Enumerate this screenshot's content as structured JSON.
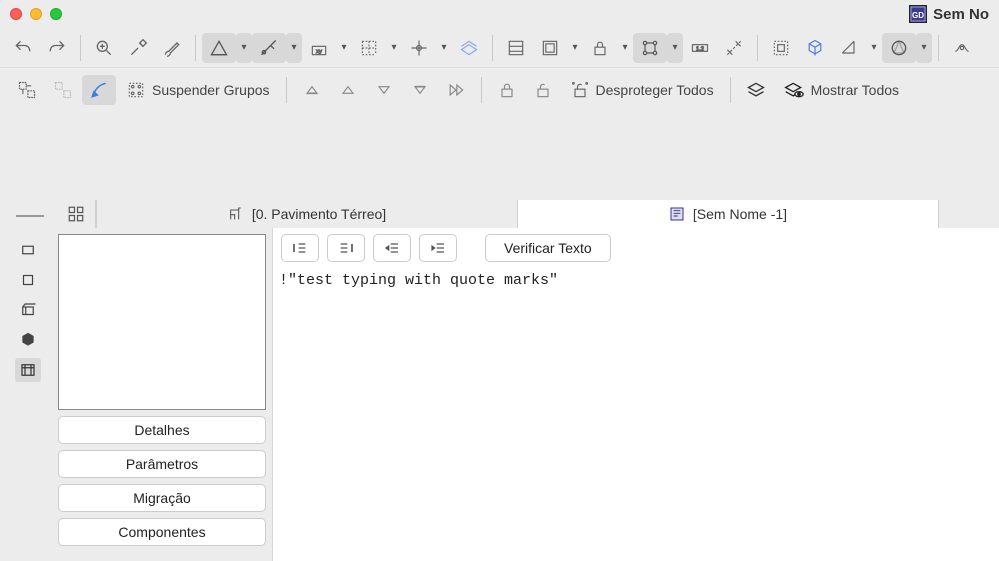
{
  "window": {
    "title": "Sem No"
  },
  "toolbar2": {
    "suspend_groups": "Suspender Grupos",
    "unprotect_all": "Desproteger Todos",
    "show_all": "Mostrar Todos"
  },
  "tabs": {
    "floor": "[0. Pavimento Térreo]",
    "unnamed": "[Sem Nome -1]"
  },
  "panel_buttons": {
    "details": "Detalhes",
    "parameters": "Parâmetros",
    "migration": "Migração",
    "components": "Componentes"
  },
  "editor": {
    "verify": "Verificar Texto",
    "content": "\"test typing with quote marks\""
  }
}
